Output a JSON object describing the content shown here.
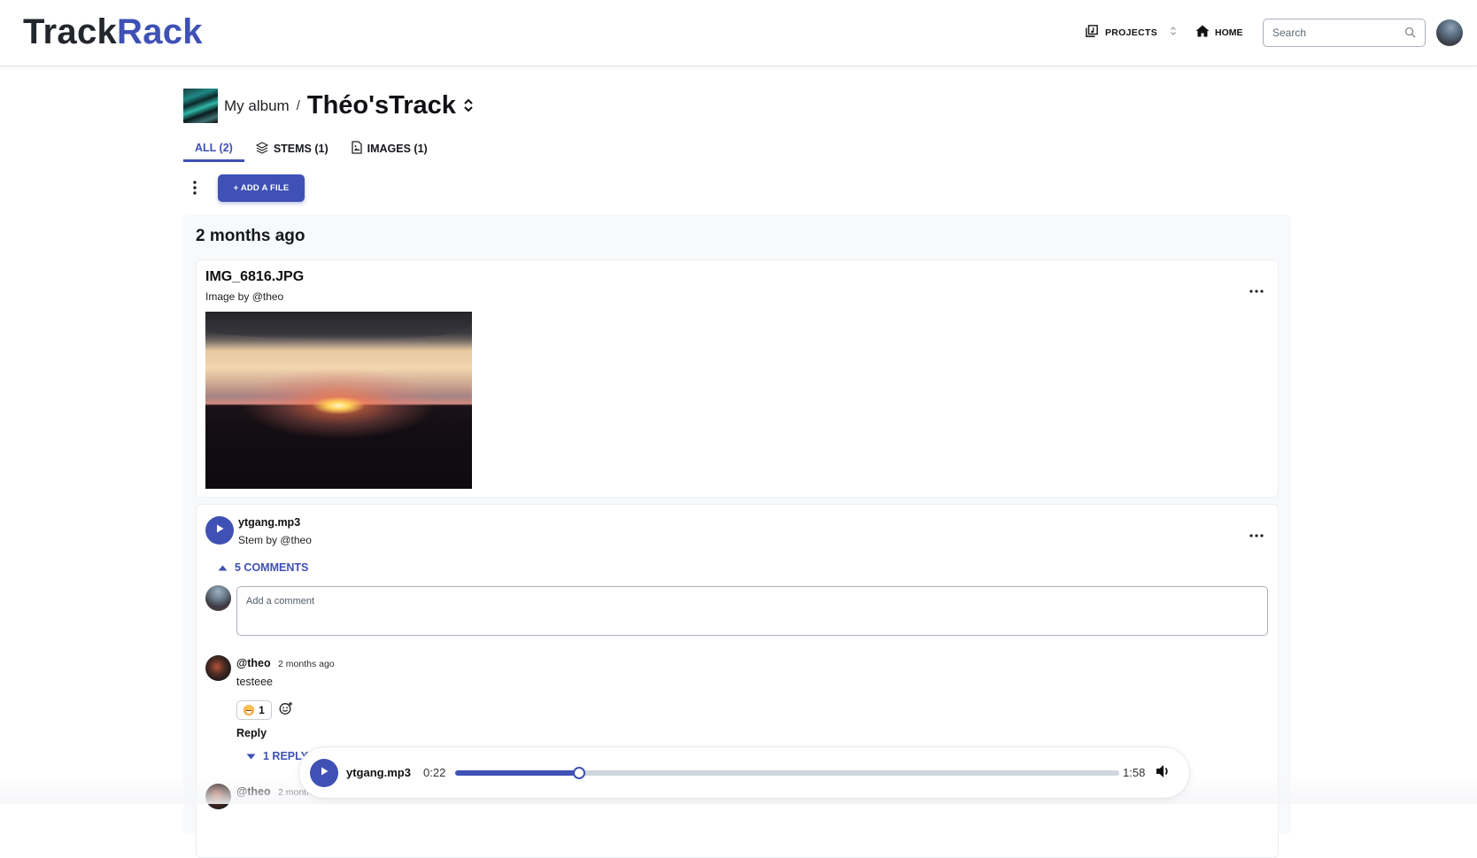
{
  "header": {
    "logo_part1": "Track",
    "logo_part2": "Rack",
    "nav": {
      "projects_label": "PROJECTS",
      "projects_icon": "music-library-icon",
      "home_label": "HOME",
      "home_icon": "home-icon"
    },
    "search": {
      "placeholder": "Search",
      "value": ""
    },
    "colors": {
      "brand": "#3f51b5",
      "logo_dark": "#23262d"
    }
  },
  "breadcrumb": {
    "album": "My album",
    "separator": "/",
    "track_title": "Théo'sTrack"
  },
  "tabs": [
    {
      "label": "ALL (2)",
      "active": true
    },
    {
      "label": "STEMS (1)",
      "icon": "layers-icon",
      "active": false
    },
    {
      "label": "IMAGES (1)",
      "icon": "image-file-icon",
      "active": false
    }
  ],
  "toolbar": {
    "add_file_label": "+ ADD A FILE"
  },
  "section": {
    "title": "2 months ago",
    "image_file": {
      "name": "IMG_6816.JPG",
      "subtitle": "Image by @theo"
    },
    "stem_file": {
      "name": "ytgang.mp3",
      "subtitle": "Stem by @theo",
      "comments_toggle": "5 COMMENTS",
      "comment_input": {
        "placeholder": "Add a comment",
        "value": ""
      },
      "comments": [
        {
          "user": "@theo",
          "time": "2 months ago",
          "text": "testeee",
          "reaction_count": "1",
          "reply_label": "Reply",
          "replies_toggle": "1 REPLY"
        },
        {
          "user": "@theo",
          "time": "2 months ago"
        }
      ]
    }
  },
  "player": {
    "file": "ytgang.mp3",
    "current": "0:22",
    "duration": "1:58",
    "progress_fraction": 0.186
  }
}
